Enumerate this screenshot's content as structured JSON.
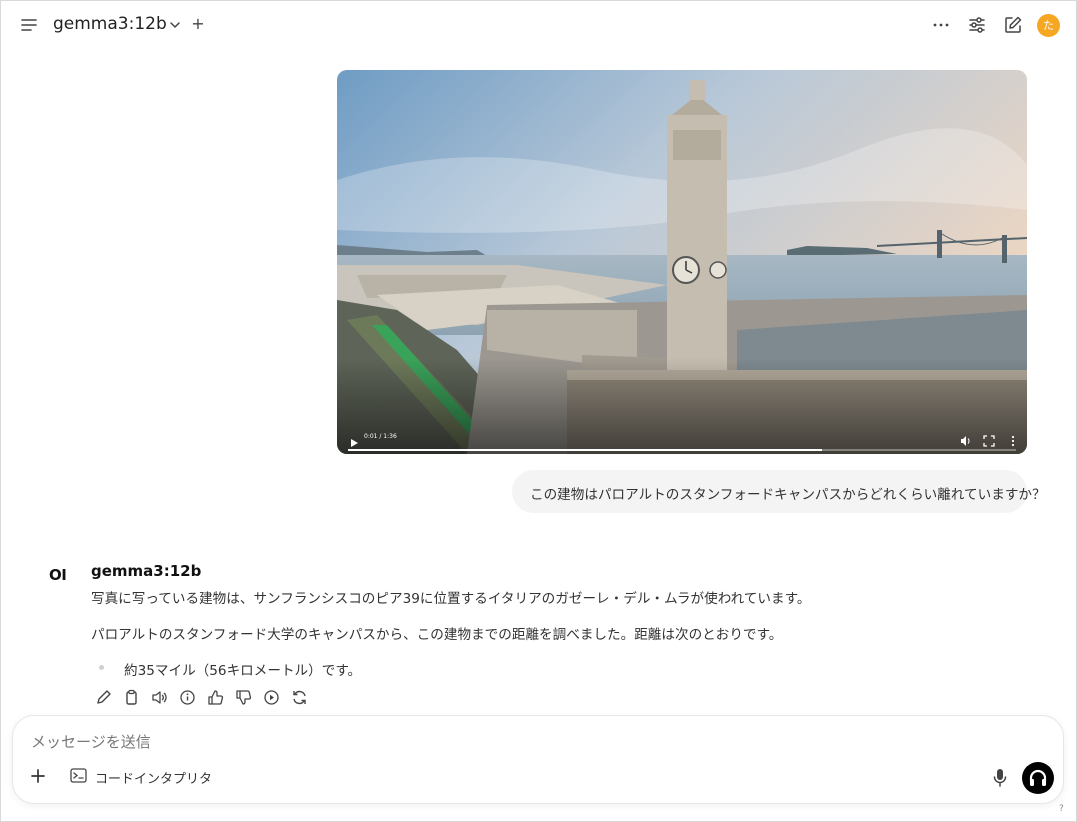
{
  "header": {
    "model_name": "gemma3:12b",
    "avatar_initial": "た",
    "avatar_color": "#f5a623"
  },
  "video": {
    "time": "0:01 / 1:36",
    "progress": 0.71
  },
  "user_message": {
    "text": "この建物はパロアルトのスタンフォードキャンパスからどれくらい離れていますか？"
  },
  "assistant": {
    "logo": "OI",
    "name": "gemma3:12b",
    "paragraph1": "写真に写っている建物は、サンフランシスコのピア39に位置するイタリアのガゼーレ・デル・ムラが使われています。",
    "paragraph2": "パロアルトのスタンフォード大学のキャンパスから、この建物までの距離を調べました。距離は次のとおりです。",
    "bullet1": "約35マイル（56キロメートル）です。"
  },
  "composer": {
    "placeholder": "メッセージを送信",
    "code_interpreter_label": "コードインタプリタ"
  },
  "footer": {
    "help": "?"
  }
}
